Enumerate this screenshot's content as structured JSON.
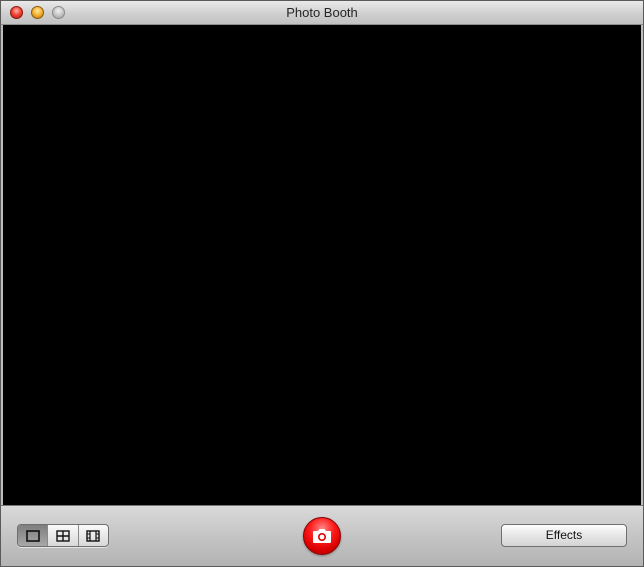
{
  "window": {
    "title": "Photo Booth"
  },
  "toolbar": {
    "view_modes": [
      {
        "name": "single-photo",
        "icon": "single-frame-icon",
        "selected": true
      },
      {
        "name": "four-up",
        "icon": "grid-four-icon",
        "selected": false
      },
      {
        "name": "movie",
        "icon": "film-strip-icon",
        "selected": false
      }
    ],
    "shutter_icon": "camera-icon",
    "effects_label": "Effects"
  },
  "colors": {
    "shutter_red": "#e00000",
    "viewport": "#000000"
  }
}
